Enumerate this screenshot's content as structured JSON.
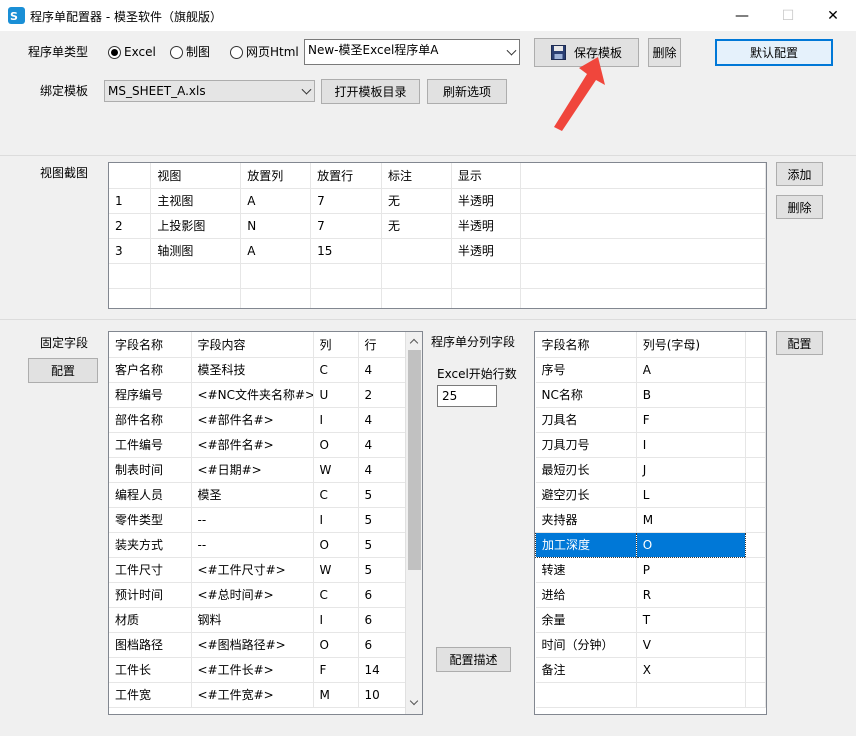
{
  "window": {
    "title": "程序单配置器 - 模圣软件（旗舰版）",
    "controls": {
      "minimize": "—",
      "maximize": "☐",
      "close": "✕"
    }
  },
  "row1": {
    "type_label": "程序单类型",
    "radio_excel": "Excel",
    "radio_drawing": "制图",
    "radio_html": "网页Html",
    "selected_type": "Excel",
    "template_combo": "New-模圣Excel程序单A",
    "save_template": "保存模板",
    "delete": "删除",
    "default_config": "默认配置"
  },
  "row2": {
    "bind_label": "绑定模板",
    "file_combo": "MS_SHEET_A.xls",
    "open_dir": "打开模板目录",
    "refresh": "刷新选项"
  },
  "views": {
    "label": "视图截图",
    "add": "添加",
    "delete": "删除",
    "headers": [
      "",
      "视图",
      "放置列",
      "放置行",
      "标注",
      "显示",
      ""
    ],
    "rows": [
      [
        "1",
        "主视图",
        "A",
        "7",
        "无",
        "半透明",
        ""
      ],
      [
        "2",
        "上投影图",
        "N",
        "7",
        "无",
        "半透明",
        ""
      ],
      [
        "3",
        "轴测图",
        "A",
        "15",
        "",
        "半透明",
        ""
      ],
      [
        "",
        "",
        "",
        "",
        "",
        "",
        ""
      ],
      [
        "",
        "",
        "",
        "",
        "",
        "",
        ""
      ]
    ]
  },
  "fixed": {
    "label": "固定字段",
    "config": "配置",
    "headers": [
      "字段名称",
      "字段内容",
      "列",
      "行"
    ],
    "rows": [
      [
        "客户名称",
        "模圣科技",
        "C",
        "4"
      ],
      [
        "程序编号",
        "<#NC文件夹名称#>",
        "U",
        "2"
      ],
      [
        "部件名称",
        "<#部件名#>",
        "I",
        "4"
      ],
      [
        "工件编号",
        "<#部件名#>",
        "O",
        "4"
      ],
      [
        "制表时间",
        "<#日期#>",
        "W",
        "4"
      ],
      [
        "编程人员",
        "模圣",
        "C",
        "5"
      ],
      [
        "零件类型",
        "--",
        "I",
        "5"
      ],
      [
        "装夹方式",
        "--",
        "O",
        "5"
      ],
      [
        "工件尺寸",
        "<#工件尺寸#>",
        "W",
        "5"
      ],
      [
        "预计时间",
        "<#总时间#>",
        "C",
        "6"
      ],
      [
        "材质",
        "钢料",
        "I",
        "6"
      ],
      [
        "图档路径",
        "<#图档路径#>",
        "O",
        "6"
      ],
      [
        "工件长",
        "<#工件长#>",
        "F",
        "14"
      ],
      [
        "工件宽",
        "<#工件宽#>",
        "M",
        "10"
      ]
    ]
  },
  "middle": {
    "label": "程序单分列字段",
    "start_row_label": "Excel开始行数",
    "start_row_value": "25",
    "describe": "配置描述"
  },
  "columns": {
    "config": "配置",
    "headers": [
      "字段名称",
      "列号(字母)",
      ""
    ],
    "selected_index": 7,
    "rows": [
      [
        "序号",
        "A",
        ""
      ],
      [
        "NC名称",
        "B",
        ""
      ],
      [
        "刀具名",
        "F",
        ""
      ],
      [
        "刀具刀号",
        "I",
        ""
      ],
      [
        "最短刃长",
        "J",
        ""
      ],
      [
        "避空刃长",
        "L",
        ""
      ],
      [
        "夹持器",
        "M",
        ""
      ],
      [
        "加工深度",
        "O",
        ""
      ],
      [
        "转速",
        "P",
        ""
      ],
      [
        "进给",
        "R",
        ""
      ],
      [
        "余量",
        "T",
        ""
      ],
      [
        "时间（分钟）",
        "V",
        ""
      ],
      [
        "备注",
        "X",
        ""
      ],
      [
        "",
        "",
        ""
      ]
    ]
  }
}
